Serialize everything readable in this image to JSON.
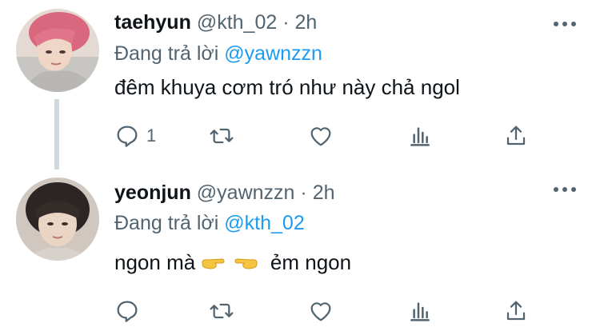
{
  "colors": {
    "accent": "#1d9bf0",
    "secondary": "#536471",
    "text": "#0f1419",
    "thread": "#cfd9de"
  },
  "tweets": [
    {
      "name": "taehyun",
      "handle": "@kth_02",
      "separator": "·",
      "time": "2h",
      "replying_prefix": "Đang trả lời",
      "replying_to": "@yawnzzn",
      "text": "đêm khuya cơm tró như này chả ngol",
      "reply_count": "1",
      "icons": [
        "reply-icon",
        "retweet-icon",
        "like-icon",
        "analytics-icon",
        "share-icon"
      ]
    },
    {
      "name": "yeonjun",
      "handle": "@yawnzzn",
      "separator": "·",
      "time": "2h",
      "replying_prefix": "Đang trả lời",
      "replying_to": "@kth_02",
      "text_before": "ngon mà",
      "emoji": [
        "backhand-index-pointing-right",
        "backhand-index-pointing-left"
      ],
      "text_after": "ẻm ngon",
      "reply_count": "",
      "icons": [
        "reply-icon",
        "retweet-icon",
        "like-icon",
        "analytics-icon",
        "share-icon"
      ]
    }
  ]
}
